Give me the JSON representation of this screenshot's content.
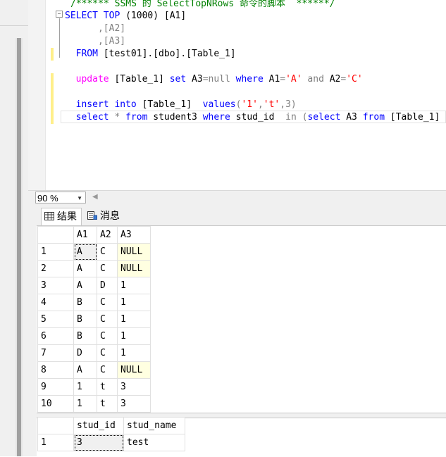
{
  "editor": {
    "comment_line": "/****** SSMS 的 SelectTopNRows 命令的脚本  ******/",
    "l1_select": "SELECT",
    "l1_top": "TOP",
    "l1_rest": " (1000) [A1]",
    "l2": "      ,[A2]",
    "l3": "      ,[A3]",
    "l4_from": "  FROM",
    "l4_rest": " [test01].[dbo].[Table_1]",
    "l6_update": "  update",
    "l6_table": " [Table_1] ",
    "l6_set": "set",
    "l6_a3": " A3",
    "l6_eq": "=",
    "l6_null": "null",
    "l6_where": " where",
    "l6_a1": " A1",
    "l6_eq2": "=",
    "l6_v1": "'A'",
    "l6_and": " and",
    "l6_a2": " A2",
    "l6_eq3": "=",
    "l6_v2": "'C'",
    "l8_insert": "  insert into",
    "l8_table": " [Table_1]  ",
    "l8_values": "values",
    "l8_paren": "(",
    "l8_v1": "'1'",
    "l8_comma1": ",",
    "l8_v2": "'t'",
    "l8_rest": ",3)",
    "l9_select": "  select",
    "l9_star": " * ",
    "l9_from": "from",
    "l9_tbl": " student3 ",
    "l9_where": "where",
    "l9_col": " stud_id  ",
    "l9_in": "in",
    "l9_paren": " (",
    "l9_select2": "select",
    "l9_a3": " A3 ",
    "l9_from2": "from",
    "l9_tbl2": " [Table_1] ",
    "l9_close": ")"
  },
  "zoom": {
    "value": "90 %"
  },
  "tabs": {
    "results": "结果",
    "messages": "消息"
  },
  "grid1": {
    "columns": [
      "A1",
      "A2",
      "A3"
    ],
    "rows": [
      [
        "1",
        "A",
        "C",
        "NULL"
      ],
      [
        "2",
        "A",
        "C",
        "NULL"
      ],
      [
        "3",
        "A",
        "D",
        "1"
      ],
      [
        "4",
        "B",
        "C",
        "1"
      ],
      [
        "5",
        "B",
        "C",
        "1"
      ],
      [
        "6",
        "B",
        "C",
        "1"
      ],
      [
        "7",
        "D",
        "C",
        "1"
      ],
      [
        "8",
        "A",
        "C",
        "NULL"
      ],
      [
        "9",
        "1",
        "t",
        "3"
      ],
      [
        "10",
        "1",
        "t",
        "3"
      ]
    ]
  },
  "grid2": {
    "columns": [
      "stud_id",
      "stud_name"
    ],
    "rows": [
      [
        "1",
        "3",
        "test"
      ]
    ]
  },
  "colors": {
    "keyword": "#0000ff",
    "pink_keyword": "#ff00ff",
    "string": "#ff0000",
    "comment": "#008000",
    "null_cell": "#ffffe1"
  }
}
